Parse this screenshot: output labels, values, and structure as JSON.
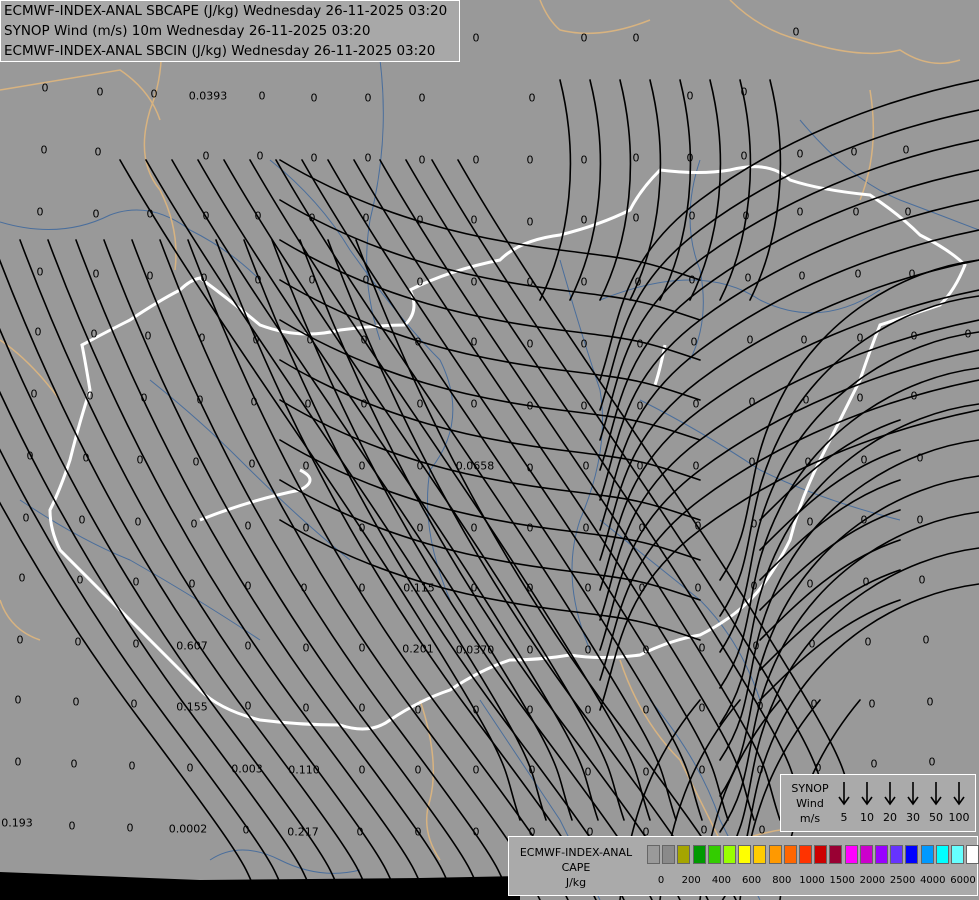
{
  "titles": {
    "line1": "ECMWF-INDEX-ANAL SBCAPE (J/kg) Wednesday 26-11-2025 03:20",
    "line2": "SYNOP Wind (m/s) 10m Wednesday 26-11-2025 03:20",
    "line3": "ECMWF-INDEX-ANAL SBCIN (J/kg) Wednesday 26-11-2025 03:20"
  },
  "colors": {
    "background": "#999999",
    "country_border": "#ffffff",
    "outer_border": "#d8b380",
    "river": "#4a6e9c",
    "streamline": "#000000"
  },
  "map_values": [
    "0.0393",
    "0.0658",
    "0.115",
    "0.607",
    "0.201",
    "0.0370",
    "0.155",
    "0.003",
    "0.110",
    "0.193",
    "0.0002",
    "0.217"
  ],
  "zero_label": "0",
  "wind_legend": {
    "title_line1": "SYNOP",
    "title_line2": "Wind",
    "title_line3": "m/s",
    "speeds": [
      "5",
      "10",
      "20",
      "30",
      "50",
      "100"
    ]
  },
  "cape_legend": {
    "title_line1": "ECMWF-INDEX-ANAL",
    "title_line2": "CAPE",
    "title_line3": "J/kg",
    "ticks": [
      "0",
      "200",
      "400",
      "600",
      "800",
      "1000",
      "1500",
      "2000",
      "2500",
      "4000",
      "6000"
    ],
    "swatches": [
      "#9a9a9a",
      "#8a8a8a",
      "#a5a500",
      "#009900",
      "#33cc00",
      "#99ff00",
      "#ffff00",
      "#ffcc00",
      "#ff9900",
      "#ff6600",
      "#ff3300",
      "#cc0000",
      "#990033",
      "#ff00ff",
      "#cc00cc",
      "#9900ff",
      "#6633ff",
      "#0000ff",
      "#0099ff",
      "#00ffff",
      "#66ffff",
      "#ffffff"
    ]
  }
}
